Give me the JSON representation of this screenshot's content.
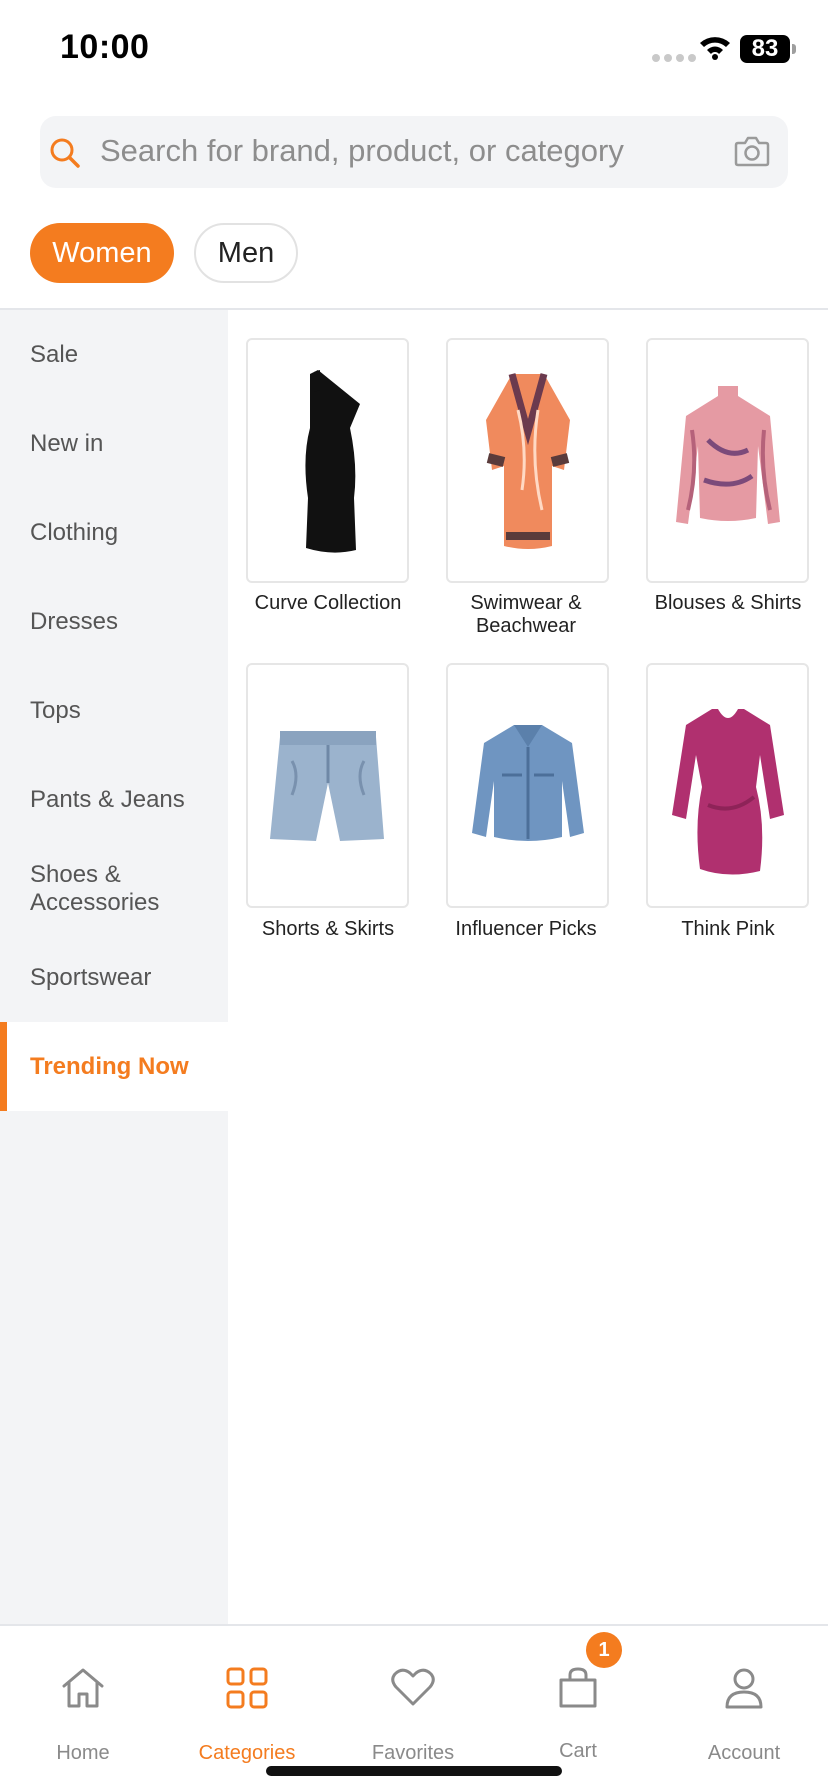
{
  "status_bar": {
    "time": "10:00",
    "battery": "83"
  },
  "search": {
    "placeholder": "Search for brand, product, or category"
  },
  "gender_tabs": [
    {
      "label": "Women",
      "selected": true
    },
    {
      "label": "Men",
      "selected": false
    }
  ],
  "sidebar": {
    "items": [
      {
        "label": "Sale"
      },
      {
        "label": "New in"
      },
      {
        "label": "Clothing"
      },
      {
        "label": "Dresses"
      },
      {
        "label": "Tops"
      },
      {
        "label": "Pants & Jeans"
      },
      {
        "label": "Shoes & Accessories"
      },
      {
        "label": "Sportswear"
      },
      {
        "label": "Trending Now",
        "active": true
      }
    ]
  },
  "categories": [
    {
      "label": "Curve Collection",
      "image": "black-one-shoulder-dress"
    },
    {
      "label": "Swimwear & Beachwear",
      "image": "orange-print-kimono"
    },
    {
      "label": "Blouses & Shirts",
      "image": "pink-print-mesh-top"
    },
    {
      "label": "Shorts & Skirts",
      "image": "denim-shorts"
    },
    {
      "label": "Influencer Picks",
      "image": "denim-jacket"
    },
    {
      "label": "Think Pink",
      "image": "magenta-dress"
    }
  ],
  "bottom_nav": {
    "items": [
      {
        "label": "Home",
        "icon": "home-icon"
      },
      {
        "label": "Categories",
        "icon": "grid-icon",
        "active": true
      },
      {
        "label": "Favorites",
        "icon": "heart-icon"
      },
      {
        "label": "Cart",
        "icon": "bag-icon"
      },
      {
        "label": "Account",
        "icon": "user-icon"
      }
    ],
    "cart_count": "1"
  },
  "colors": {
    "accent": "#f47c1f",
    "sidebar_bg": "#f3f4f6",
    "muted_text": "#8a8a8a"
  }
}
